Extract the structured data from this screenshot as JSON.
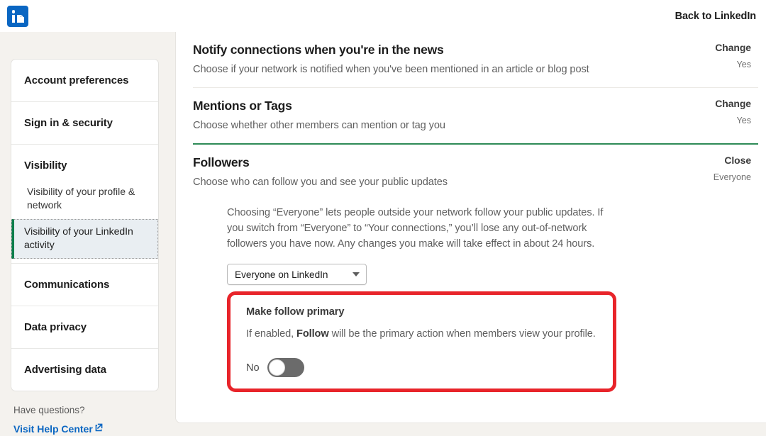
{
  "header": {
    "logo_icon": "linkedin-logo-icon",
    "back_label": "Back to LinkedIn"
  },
  "sidebar": {
    "groups": [
      {
        "label": "Account preferences",
        "items": []
      },
      {
        "label": "Sign in & security",
        "items": []
      },
      {
        "label": "Visibility",
        "items": [
          {
            "label": "Visibility of your profile & network",
            "active": false
          },
          {
            "label": "Visibility of your LinkedIn activity",
            "active": true
          }
        ]
      },
      {
        "label": "Communications",
        "items": []
      },
      {
        "label": "Data privacy",
        "items": []
      },
      {
        "label": "Advertising data",
        "items": []
      }
    ],
    "help": {
      "question": "Have questions?",
      "link_label": "Visit Help Center",
      "link_icon": "external-link-icon"
    }
  },
  "main": {
    "sections": [
      {
        "title": "Notify connections when you're in the news",
        "description": "Choose if your network is notified when you've been mentioned in an article or blog post",
        "action_label": "Change",
        "action_value": "Yes"
      },
      {
        "title": "Mentions or Tags",
        "description": "Choose whether other members can mention or tag you",
        "action_label": "Change",
        "action_value": "Yes"
      },
      {
        "title": "Followers",
        "description": "Choose who can follow you and see your public updates",
        "action_label": "Close",
        "action_value": "Everyone"
      }
    ],
    "followers_panel": {
      "body": "Choosing “Everyone” lets people outside your network follow your public updates. If you switch from “Everyone” to “Your connections,” you’ll lose any out-of-network followers you have now. Any changes you make will take effect in about 24 hours.",
      "select": {
        "value": "Everyone on LinkedIn",
        "caret_icon": "chevron-down-icon"
      },
      "highlight": {
        "title": "Make follow primary",
        "copy_before": "If enabled, ",
        "copy_bold": "Follow",
        "copy_after": " will be the primary action when members view your profile.",
        "toggle_label": "No",
        "toggle_state": "off"
      }
    }
  },
  "colors": {
    "brand_blue": "#0a66c2",
    "page_bg": "#f4f2ee",
    "accent_green": "#2e8b57",
    "active_green": "#0a7d4b",
    "highlight_red": "#e8242a",
    "toggle_off": "#6b6b6b"
  }
}
